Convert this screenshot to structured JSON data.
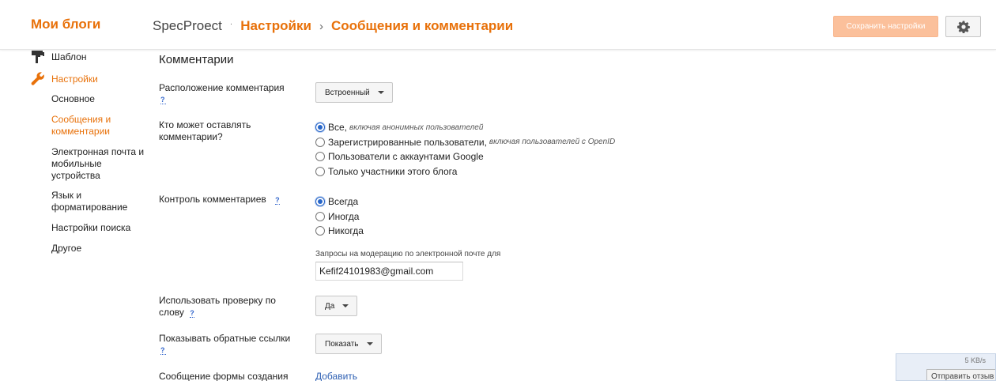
{
  "header": {
    "brand": "Мои блоги",
    "blog_name": "SpecProect",
    "dot": "·",
    "crumb_settings": "Настройки",
    "sep": "›",
    "crumb_page": "Сообщения и комментарии",
    "save_label": "Сохранить настройки",
    "settings_icon": "gear-icon"
  },
  "sidebar": {
    "template_label": "Шаблон",
    "template_icon": "paint-roller-icon",
    "settings_label": "Настройки",
    "settings_icon": "wrench-icon",
    "items": [
      "Основное",
      "Сообщения и комментарии",
      "Электронная почта и мобильные устройства",
      "Язык и форматирование",
      "Настройки поиска",
      "Другое"
    ],
    "active_index": 1
  },
  "main": {
    "section_title": "Комментарии",
    "help_mark": "?",
    "placement": {
      "label": "Расположение комментария",
      "value": "Встроенный"
    },
    "who_can": {
      "label": "Кто может оставлять комментарии?",
      "options": [
        {
          "label": "Все,",
          "note": "включая анонимных пользователей",
          "checked": true
        },
        {
          "label": "Зарегистрированные пользователи,",
          "note": "включая пользователей с OpenID",
          "checked": false
        },
        {
          "label": "Пользователи с аккаунтами Google",
          "note": "",
          "checked": false
        },
        {
          "label": "Только участники этого блога",
          "note": "",
          "checked": false
        }
      ]
    },
    "moderation": {
      "label": "Контроль комментариев",
      "options": [
        {
          "label": "Всегда",
          "checked": true
        },
        {
          "label": "Иногда",
          "checked": false
        },
        {
          "label": "Никогда",
          "checked": false
        }
      ],
      "email_label": "Запросы на модерацию по электронной почте для",
      "email_value": "Kefif24101983@gmail.com"
    },
    "word_verification": {
      "label": "Использовать проверку по слову",
      "value": "Да"
    },
    "backlinks": {
      "label": "Показывать обратные ссылки",
      "value": "Показать"
    },
    "form_message": {
      "label": "Сообщение формы создания",
      "link": "Добавить"
    }
  },
  "widget": {
    "speed": "5 KB/s",
    "feedback_label": "Отправить отзыв"
  },
  "colors": {
    "accent": "#e8710a",
    "save_button": "#fbc09b",
    "link": "#2d5fb3"
  }
}
